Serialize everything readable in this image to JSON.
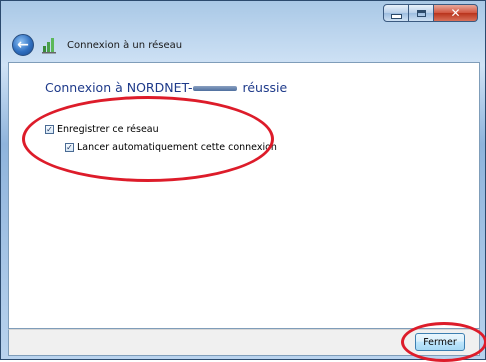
{
  "window": {
    "nav_title": "Connexion à un réseau",
    "back_icon": "back-arrow-icon",
    "net_icon": "network-icon",
    "controls": {
      "minimize_icon": "minimize-icon",
      "maximize_icon": "maximize-icon",
      "close_icon": "close-icon"
    }
  },
  "main": {
    "heading_prefix": "Connexion à NORDNET-",
    "heading_suffix": "réussie",
    "checkboxes": [
      {
        "label": "Enregistrer ce réseau",
        "checked": true
      },
      {
        "label": "Lancer automatiquement cette connexion",
        "checked": true
      }
    ]
  },
  "footer": {
    "close_label": "Fermer"
  },
  "colors": {
    "heading": "#1e3a8a",
    "annotation": "#dd1c2a"
  }
}
